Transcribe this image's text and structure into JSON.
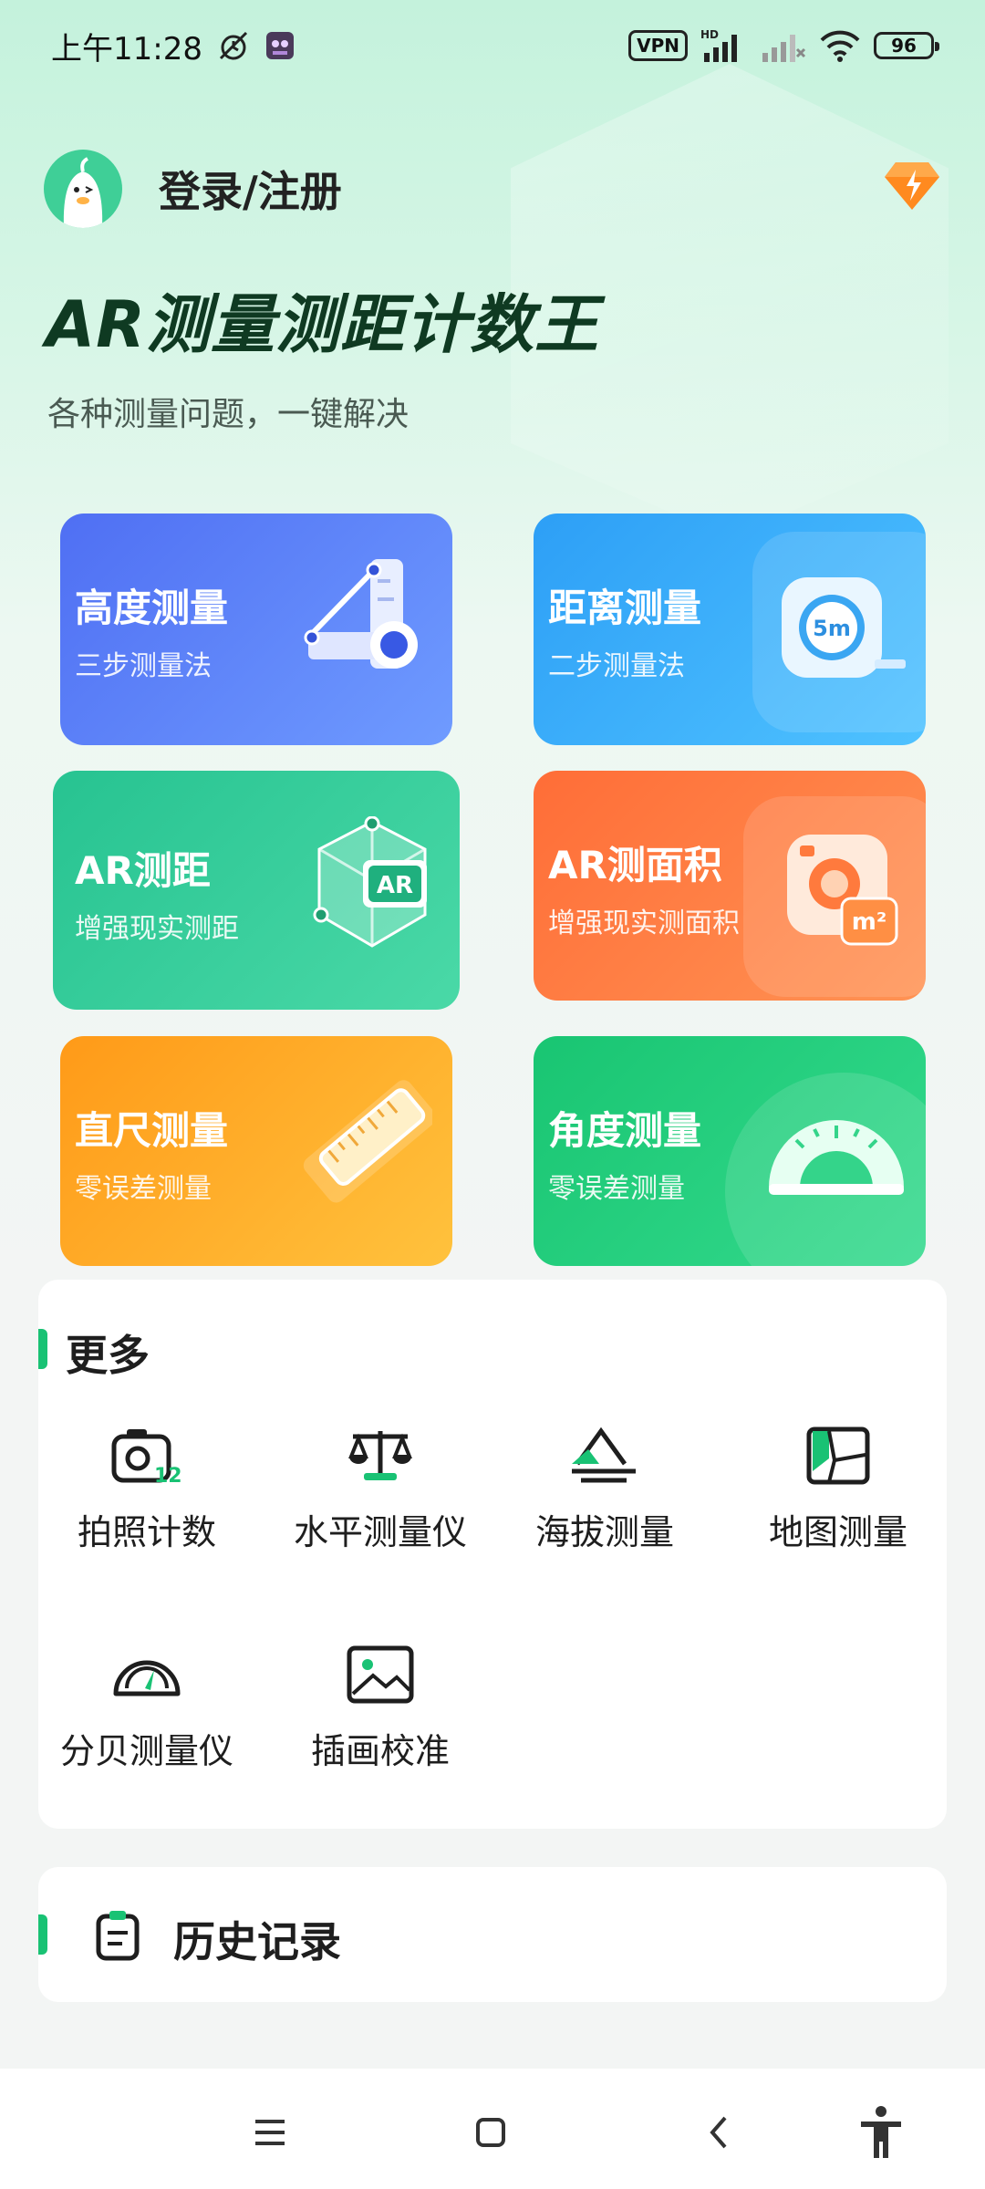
{
  "status_bar": {
    "time": "上午11:28",
    "vpn": "VPN",
    "battery": "96",
    "hd": "HD"
  },
  "header": {
    "login": "登录/注册"
  },
  "hero": {
    "title": "AR测量测距计数王",
    "subtitle": "各种测量问题，一键解决"
  },
  "cards": [
    {
      "title": "高度测量",
      "subtitle": "三步测量法"
    },
    {
      "title": "距离测量",
      "subtitle": "二步测量法",
      "icon_text": "5m"
    },
    {
      "title": "AR测距",
      "subtitle": "增强现实测距",
      "icon_text": "AR"
    },
    {
      "title": "AR测面积",
      "subtitle": "增强现实测面积",
      "icon_text": "m²"
    },
    {
      "title": "直尺测量",
      "subtitle": "零误差测量"
    },
    {
      "title": "角度测量",
      "subtitle": "零误差测量"
    }
  ],
  "more": {
    "title": "更多",
    "tools": [
      {
        "label": "拍照计数",
        "icon": "camera-count-icon",
        "badge": "12"
      },
      {
        "label": "水平测量仪",
        "icon": "level-icon"
      },
      {
        "label": "海拔测量",
        "icon": "mountain-icon"
      },
      {
        "label": "地图测量",
        "icon": "map-icon"
      },
      {
        "label": "分贝测量仪",
        "icon": "decibel-meter-icon"
      },
      {
        "label": "插画校准",
        "icon": "image-icon"
      }
    ]
  },
  "history": {
    "title": "历史记录"
  },
  "colors": {
    "accent": "#19c274",
    "blue": "#4f6ff3",
    "sky": "#2d9ff6",
    "teal": "#27c391",
    "orange": "#ff6d37",
    "amber": "#ff9a18",
    "green": "#19c572"
  }
}
